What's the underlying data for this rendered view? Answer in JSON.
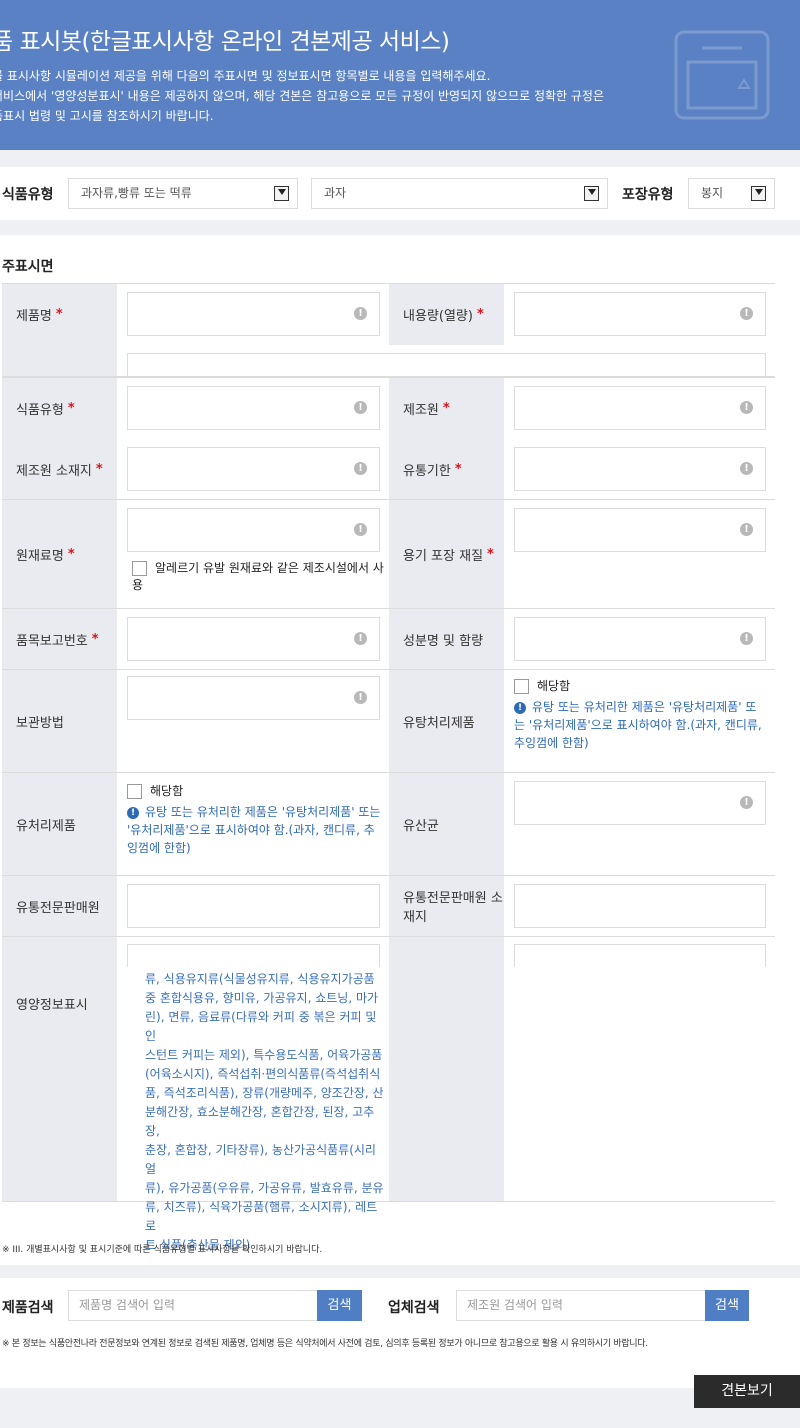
{
  "banner": {
    "title": "품 표시봇(한글표시사항 온라인 견본제공 서비스)",
    "description": "를 표시사항 시뮬레이션 제공을 위해 다음의 주표시면 및 정보표시면 항목별로 내용을 입력해주세요.\n 서비스에서 '영양성분표시' 내용은 제공하지 않으며, 해당 견본은 참고용으로 모든 규정이 반영되지 않으므로 정확한 규정은\n품표시 법령 및 고시를 참조하시기 바랍니다."
  },
  "filters": {
    "food_type_label": "식품유형",
    "food_type_value": "과자류,빵류 또는 떡류",
    "sub_type_value": "과자",
    "package_label": "포장유형",
    "package_value": "봉지"
  },
  "form": {
    "section_title": "주표시면",
    "product_name": "제품명",
    "volume": "내용량(열량)",
    "food_type": "식품유형",
    "manufacturer": "제조원",
    "manufacturer_address": "제조원 소재지",
    "expiry": "유통기한",
    "ingredients": "원재료명",
    "allergy_checkbox": "알레르기 유발 원재료와 같은 제조시설에서 사용",
    "container_material": "용기 포장 재질",
    "report_number": "품목보고번호",
    "component_content": "성분명 및 함량",
    "storage": "보관방법",
    "sugar_processed": "유탕처리제품",
    "applicable": "해당함",
    "sugar_note": "유탕 또는 유처리한 제품은 '유탕처리제품' 또는 '유처리제품'으로 표시하여야 함.(과자, 캔디류, 추잉껌에 한함)",
    "oil_processed": "유처리제품",
    "lactic": "유산균",
    "distributor": "유통전문판매원",
    "distributor_address": "유통전문판매원 소재지",
    "nutrition": "영양정보표시",
    "nutrition_list": "류, 식용유지류(식물성유지류, 식용유지가공품\n중 혼합식용유, 향미유, 가공유지, 쇼트닝, 마가\n린), 면류, 음료류(다류와 커피 중 볶은 커피 및 인\n스턴트 커피는 제외), 특수용도식품, 어육가공품\n(어육소시지), 즉석섭취·편의식품류(즉석섭취식\n품, 즉석조리식품), 장류(개량메주, 양조간장, 산\n분해간장, 효소분해간장, 혼합간장, 된장, 고추장,\n춘장, 혼합장, 기타장류), 농산가공식품류(시리얼\n류), 유가공품(우유류, 가공유류, 발효유류, 분유\n류, 치즈류), 식육가공품(햄류, 소시지류), 레트로\n트 식품(축산물 제외)"
  },
  "footnote": "※ III. 개별표시사항 및 표시기준에 따른 식품유형별 표시사항을 확인하시기 바랍니다.",
  "search": {
    "product_label": "제품검색",
    "product_placeholder": "제품명 검색어 입력",
    "product_button": "검색",
    "company_label": "업체검색",
    "company_placeholder": "제조원 검색어 입력",
    "company_button": "검색",
    "disclaimer": "※ 본 정보는 식품안전나라 전문정보와 연계된 정보로 검색된 제품명, 업체명 등은 식약처에서 사전에 검토, 심의후 등록된 정보가 아니므로 참고용으로 활용 시 유의하시기 바랍니다."
  },
  "actions": {
    "view_sample": "견본보기"
  },
  "icons": {
    "exclamation": "!",
    "info": "!"
  }
}
